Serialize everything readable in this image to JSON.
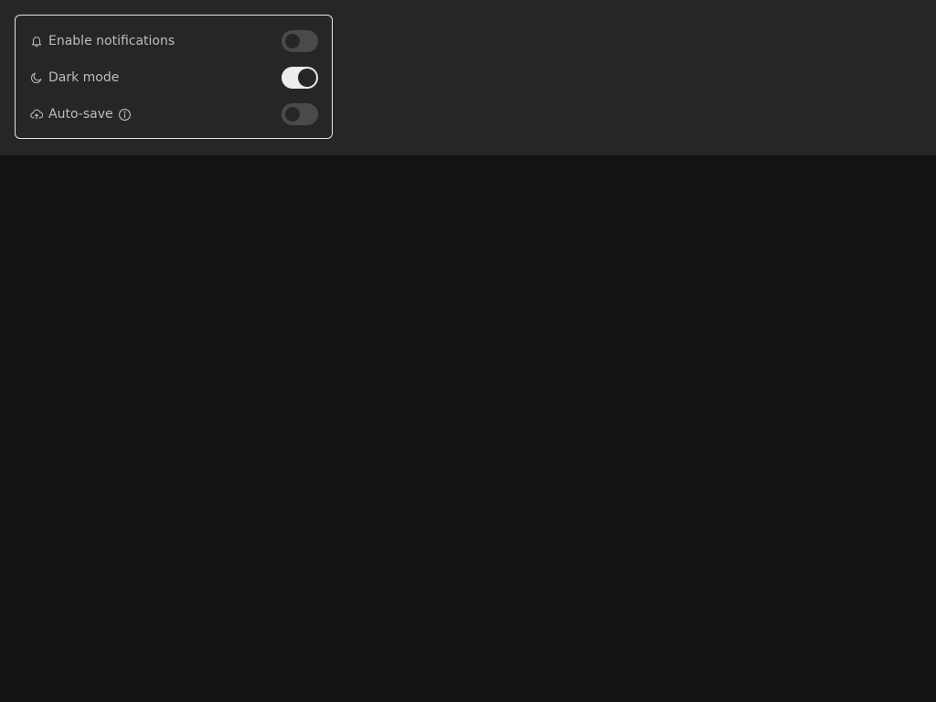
{
  "settings": {
    "items": [
      {
        "label": "Enable notifications",
        "icon": "bell-icon",
        "enabled": false
      },
      {
        "label": "Dark mode",
        "icon": "moon-icon",
        "enabled": true
      },
      {
        "label": "Auto-save",
        "icon": "cloud-upload-icon",
        "info_icon": "info-icon",
        "enabled": false
      }
    ]
  },
  "colors": {
    "page_background": "#131313",
    "panel_background": "#262626",
    "card_border": "#e6e6e6",
    "label_text": "#bdbdbd",
    "toggle_on_track": "#ececec",
    "toggle_off_track": "#4a4a4a"
  }
}
